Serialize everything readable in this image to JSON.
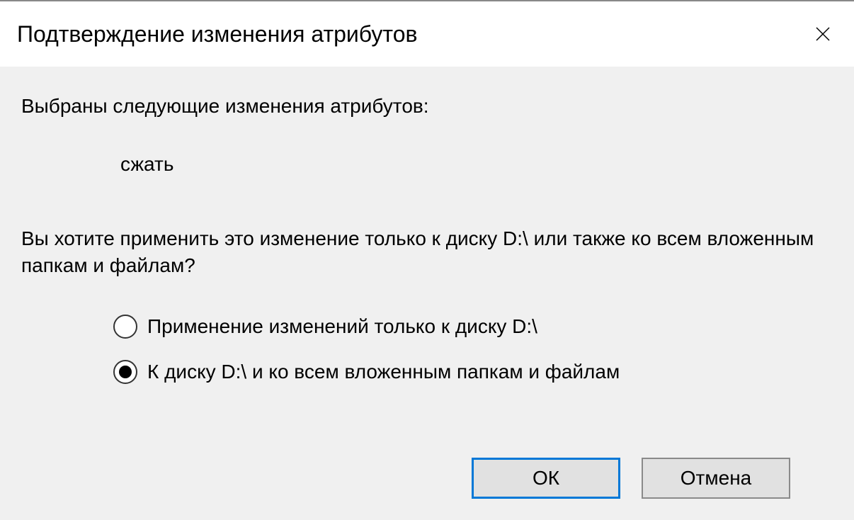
{
  "dialog": {
    "title": "Подтверждение изменения атрибутов",
    "intro": "Выбраны следующие изменения атрибутов:",
    "change": "сжать",
    "question": "Вы хотите применить это изменение только к диску D:\\ или также ко всем вложенным папкам и файлам?",
    "options": [
      {
        "label": "Применение изменений только к диску D:\\",
        "checked": false
      },
      {
        "label": "К диску D:\\ и ко всем вложенным папкам и файлам",
        "checked": true
      }
    ],
    "buttons": {
      "ok": "ОК",
      "cancel": "Отмена"
    }
  }
}
